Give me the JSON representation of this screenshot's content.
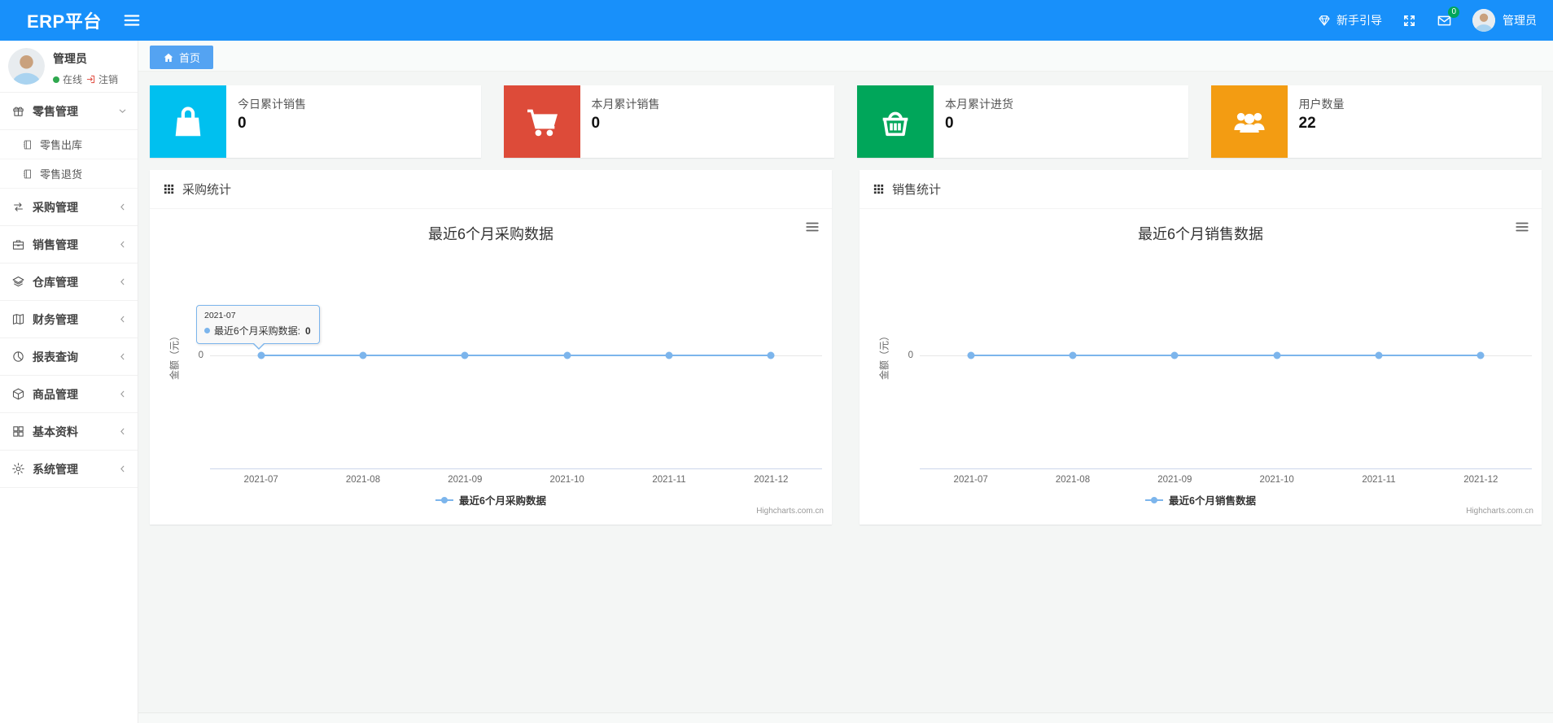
{
  "navbar": {
    "brand": "ERP平台",
    "guide_label": "新手引导",
    "messages_badge": "0",
    "user_name": "管理员"
  },
  "sidebar": {
    "user": {
      "name": "管理员",
      "status_online": "在线",
      "logout_label": "注销"
    },
    "menu": [
      {
        "id": "retail-mgmt",
        "label": "零售管理",
        "icon": "gift-icon",
        "state": "expanded",
        "children": [
          {
            "id": "retail-outbound",
            "label": "零售出库",
            "icon": "notebook-icon"
          },
          {
            "id": "retail-return",
            "label": "零售退货",
            "icon": "notebook-icon"
          }
        ]
      },
      {
        "id": "purchase-mgmt",
        "label": "采购管理",
        "icon": "exchange-icon",
        "state": "collapsed",
        "children": []
      },
      {
        "id": "sales-mgmt",
        "label": "销售管理",
        "icon": "briefcase-icon",
        "state": "collapsed",
        "children": []
      },
      {
        "id": "warehouse-mgmt",
        "label": "仓库管理",
        "icon": "layers-icon",
        "state": "collapsed",
        "children": []
      },
      {
        "id": "finance-mgmt",
        "label": "财务管理",
        "icon": "map-book-icon",
        "state": "collapsed",
        "children": []
      },
      {
        "id": "report-query",
        "label": "报表查询",
        "icon": "pie-chart-icon",
        "state": "collapsed",
        "children": []
      },
      {
        "id": "product-mgmt",
        "label": "商品管理",
        "icon": "package-icon",
        "state": "collapsed",
        "children": []
      },
      {
        "id": "basic-data",
        "label": "基本资料",
        "icon": "grid-icon",
        "state": "collapsed",
        "children": []
      },
      {
        "id": "system-mgmt",
        "label": "系统管理",
        "icon": "gear-icon",
        "state": "collapsed",
        "children": []
      }
    ]
  },
  "breadcrumb": {
    "home_label": "首页"
  },
  "stat_cards": [
    {
      "label": "今日累计销售",
      "value": "0",
      "color": "#00c0ef",
      "icon": "shopping-bag-icon"
    },
    {
      "label": "本月累计销售",
      "value": "0",
      "color": "#dd4b39",
      "icon": "shopping-cart-icon"
    },
    {
      "label": "本月累计进货",
      "value": "0",
      "color": "#00a65a",
      "icon": "shopping-basket-icon"
    },
    {
      "label": "用户数量",
      "value": "22",
      "color": "#f39c12",
      "icon": "users-icon"
    }
  ],
  "chart_data": [
    {
      "type": "line",
      "panel_title": "采购统计",
      "title": "最近6个月采购数据",
      "categories": [
        "2021-07",
        "2021-08",
        "2021-09",
        "2021-10",
        "2021-11",
        "2021-12"
      ],
      "series": [
        {
          "name": "最近6个月采购数据",
          "values": [
            0,
            0,
            0,
            0,
            0,
            0
          ],
          "color": "#7cb5ec"
        }
      ],
      "xlabel": "",
      "ylabel": "金额（元）",
      "yticks": [
        "0"
      ],
      "legend_position": "bottom",
      "grid": true,
      "credits": "Highcharts.com.cn",
      "tooltip": {
        "visible": true,
        "header": "2021-07",
        "series_label": "最近6个月采购数据:",
        "value": "0"
      }
    },
    {
      "type": "line",
      "panel_title": "销售统计",
      "title": "最近6个月销售数据",
      "categories": [
        "2021-07",
        "2021-08",
        "2021-09",
        "2021-10",
        "2021-11",
        "2021-12"
      ],
      "series": [
        {
          "name": "最近6个月销售数据",
          "values": [
            0,
            0,
            0,
            0,
            0,
            0
          ],
          "color": "#7cb5ec"
        }
      ],
      "xlabel": "",
      "ylabel": "金额（元）",
      "yticks": [
        "0"
      ],
      "legend_position": "bottom",
      "grid": true,
      "credits": "Highcharts.com.cn",
      "tooltip": {
        "visible": false,
        "header": "",
        "series_label": "",
        "value": ""
      }
    }
  ]
}
